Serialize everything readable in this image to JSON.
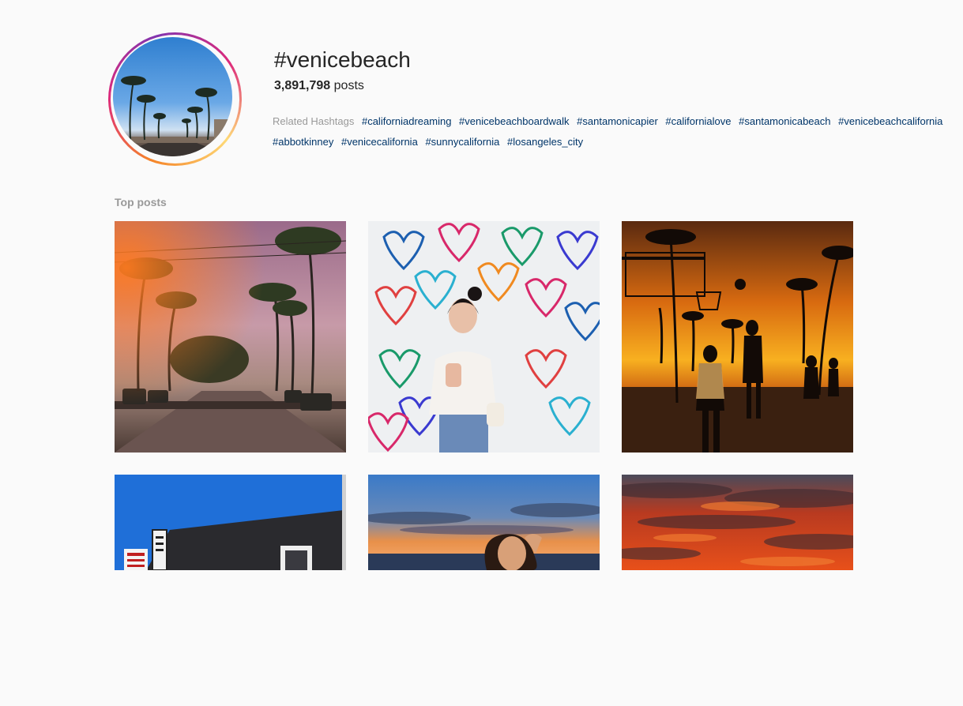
{
  "hashtag": {
    "title": "#venicebeach",
    "post_count": "3,891,798",
    "post_label": "posts"
  },
  "related": {
    "label": "Related Hashtags",
    "tags": [
      "#californiadreaming",
      "#venicebeachboardwalk",
      "#santamonicapier",
      "#californialove",
      "#santamonicabeach",
      "#venicebeachcalifornia",
      "#abbotkinney",
      "#venicecalifornia",
      "#sunnycalifornia",
      "#losangeles_city"
    ]
  },
  "top_posts": {
    "label": "Top posts",
    "posts": [
      {
        "icon": "palm-street-photo"
      },
      {
        "icon": "heart-mural-photo"
      },
      {
        "icon": "basketball-sunset-photo"
      },
      {
        "icon": "cafe-building-photo"
      },
      {
        "icon": "beach-portrait-photo"
      },
      {
        "icon": "red-clouds-photo"
      }
    ]
  },
  "colors": {
    "link": "#003569",
    "muted": "#999999",
    "text": "#262626",
    "background": "#fafafa"
  }
}
